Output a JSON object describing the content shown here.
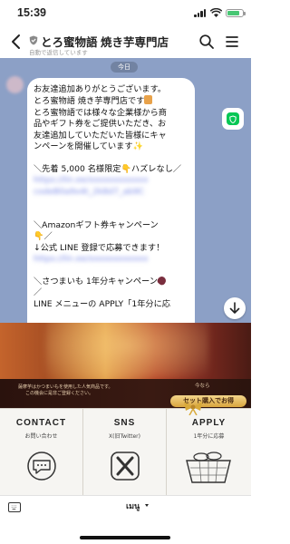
{
  "status": {
    "time": "15:39"
  },
  "header": {
    "title": "とろ蜜物語 焼き芋専門店",
    "subtitle": "自動で返信しています"
  },
  "chat": {
    "date": "今日",
    "lines": [
      "お友達追加ありがとうございます。",
      "とろ蜜物語 焼き芋専門店です",
      "とろ蜜物語では様々な企業様から商",
      "品やギフト券をご提供いただき、お",
      "友達追加していただいた皆様にキャ",
      "ンペーンを開催しています",
      "",
      "＼先着 5,000 名様限定",
      "ハズレなし／",
      "",
      "",
      "",
      "",
      "＼Amazonギフト券キャンペーン",
      "／",
      "↓公式 LINE 登録で応募できます！",
      "",
      "",
      "＼さつまいも 1年分キャンペーン",
      "／",
      "LINE メニューの APPLY「1年分に応"
    ],
    "blurred_links": [
      "https://lin.ee/xxxxxxxxxxxx",
      "codeB0a9x4t_2k8d7_ab9C",
      "https://lin.ee/xxxxxxxxxxxx",
      "https://lin.ee/xxxxxxxxxxxx"
    ]
  },
  "banner": {
    "line1": "薩摩芋はかつまいもを使用した人気商品です。",
    "line2": "この機会に是非ご登録ください。",
    "caption": "今なら",
    "set_button": "セット購入でお得"
  },
  "menu": {
    "items": [
      {
        "title": "CONTACT",
        "sub": "お問い合わせ",
        "icon": "chat-bubble-icon"
      },
      {
        "title": "SNS",
        "sub": "X(旧Twitter)",
        "icon": "x-logo-icon"
      },
      {
        "title": "APPLY",
        "sub": "1年分に応募",
        "icon": "gift-box-icon"
      }
    ]
  },
  "bottom": {
    "menu_label": "เมนู"
  },
  "colors": {
    "chat_bg": "#8ca0c6",
    "line_green": "#06c755"
  }
}
